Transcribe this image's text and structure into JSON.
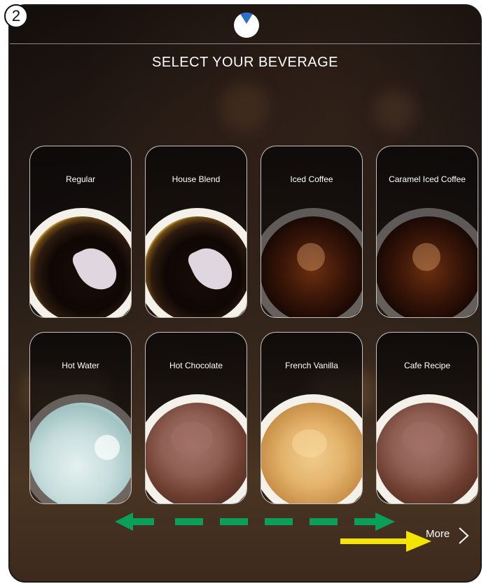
{
  "step_badge": "2",
  "header": {
    "title": "SELECT YOUR BEVERAGE"
  },
  "beverages": [
    {
      "label": "Regular",
      "style": "black-coffee"
    },
    {
      "label": "House Blend",
      "style": "black-coffee"
    },
    {
      "label": "Iced Coffee",
      "style": "iced-coffee"
    },
    {
      "label": "Caramel Iced Coffee",
      "style": "iced-coffee"
    },
    {
      "label": "Hot Water",
      "style": "water"
    },
    {
      "label": "Hot Chocolate",
      "style": "chocolate"
    },
    {
      "label": "French Vanilla",
      "style": "vanilla"
    },
    {
      "label": "Cafe Recipe",
      "style": "chocolate"
    }
  ],
  "footer": {
    "more_label": "More"
  },
  "colors": {
    "swipe_arrow": "#0aa05a",
    "pointer_arrow": "#f5e400",
    "logo_accent": "#2a6fc9"
  }
}
